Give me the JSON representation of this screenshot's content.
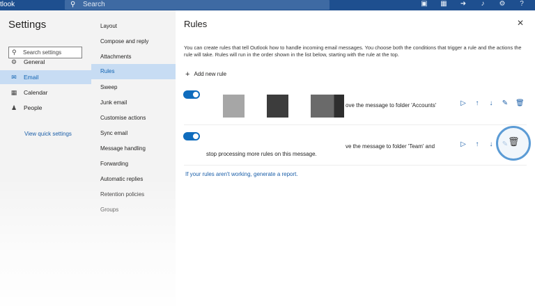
{
  "topbar": {
    "app_name": "tlook",
    "search_placeholder": "Search",
    "icons": [
      "meeting-icon",
      "office-icon",
      "share-icon",
      "bell-icon",
      "gear-icon",
      "help-icon"
    ]
  },
  "settings": {
    "title": "Settings",
    "search_placeholder": "Search settings",
    "nav": [
      {
        "label": "General",
        "icon": "gear-icon"
      },
      {
        "label": "Email",
        "icon": "mail-icon"
      },
      {
        "label": "Calendar",
        "icon": "calendar-icon"
      },
      {
        "label": "People",
        "icon": "people-icon"
      }
    ],
    "quick_settings": "View quick settings"
  },
  "email_menu": {
    "items": [
      "Layout",
      "Compose and reply",
      "Attachments",
      "Rules",
      "Sweep",
      "Junk email",
      "Customise actions",
      "Sync email",
      "Message handling",
      "Forwarding",
      "Automatic replies",
      "Retention policies",
      "Groups"
    ],
    "active": "Rules"
  },
  "rules": {
    "title": "Rules",
    "description": "You can create rules that tell Outlook how to handle incoming email messages. You choose both the conditions that trigger a rule and the actions the rule will take. Rules will run in the order shown in the list below, starting with the rule at the top.",
    "add_new": "Add new rule",
    "items": [
      {
        "enabled": true,
        "text": "ove the message to folder 'Accounts'"
      },
      {
        "enabled": true,
        "text_line1": "ve the message to folder 'Team' and",
        "text_line2": "stop processing more rules on this message."
      }
    ],
    "report_link": "If your rules aren't working, generate a report."
  }
}
